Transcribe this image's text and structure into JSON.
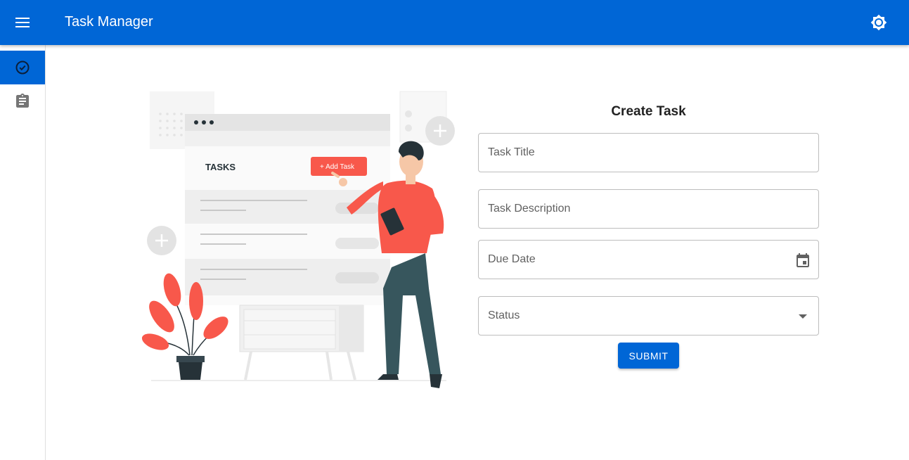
{
  "appbar": {
    "title": "Task Manager",
    "menu_icon": "menu-icon",
    "theme_icon": "brightness-icon",
    "color": "#0066d6"
  },
  "sidebar": {
    "items": [
      {
        "icon": "check-circle-icon",
        "active": true
      },
      {
        "icon": "clipboard-icon",
        "active": false
      }
    ]
  },
  "illustration": {
    "board_title": "TASKS",
    "add_button_label": "+ Add Task"
  },
  "form": {
    "title": "Create Task",
    "fields": {
      "title_placeholder": "Task Title",
      "description_placeholder": "Task Description",
      "due_date_placeholder": "Due Date",
      "status_placeholder": "Status"
    },
    "submit_label": "SUBMIT"
  },
  "colors": {
    "primary": "#0066d6",
    "accent_illustration": "#f8584b"
  }
}
